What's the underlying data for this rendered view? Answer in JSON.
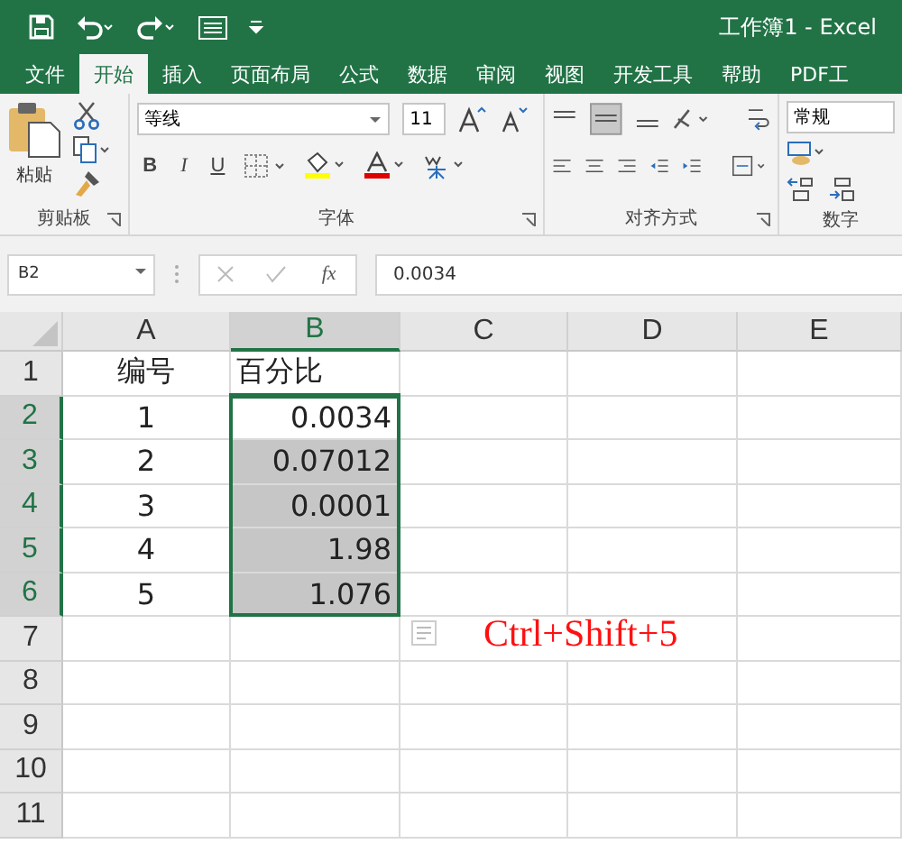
{
  "window": {
    "title": "工作簿1  -  Excel"
  },
  "tabs": [
    {
      "label": "文件",
      "selected": false
    },
    {
      "label": "开始",
      "selected": true
    },
    {
      "label": "插入",
      "selected": false
    },
    {
      "label": "页面布局",
      "selected": false
    },
    {
      "label": "公式",
      "selected": false
    },
    {
      "label": "数据",
      "selected": false
    },
    {
      "label": "审阅",
      "selected": false
    },
    {
      "label": "视图",
      "selected": false
    },
    {
      "label": "开发工具",
      "selected": false
    },
    {
      "label": "帮助",
      "selected": false
    },
    {
      "label": "PDF工",
      "selected": false
    }
  ],
  "ribbon": {
    "paste_label": "粘贴",
    "font_name": "等线",
    "font_size": "11",
    "number_format": "常规",
    "bold": "B",
    "italic": "I",
    "underline": "U",
    "groups": [
      "剪贴板",
      "字体",
      "对齐方式",
      "数字"
    ]
  },
  "formula_bar": {
    "name_box": "B2",
    "fx": "fx",
    "value": "0.0034"
  },
  "columns": [
    {
      "label": "A",
      "selected": false
    },
    {
      "label": "B",
      "selected": true
    },
    {
      "label": "C",
      "selected": false
    },
    {
      "label": "D",
      "selected": false
    },
    {
      "label": "E",
      "selected": false
    }
  ],
  "rows": [
    {
      "label": "1",
      "selected": false,
      "cells": [
        {
          "text": "编号",
          "kind": "centered",
          "selected": false,
          "active": false
        },
        {
          "text": "百分比",
          "kind": "text",
          "selected": false,
          "active": false
        }
      ]
    },
    {
      "label": "2",
      "selected": true,
      "cells": [
        {
          "text": "1",
          "kind": "centered",
          "selected": false,
          "active": false
        },
        {
          "text": "0.0034",
          "kind": "number",
          "selected": true,
          "active": true
        }
      ]
    },
    {
      "label": "3",
      "selected": true,
      "cells": [
        {
          "text": "2",
          "kind": "centered",
          "selected": false,
          "active": false
        },
        {
          "text": "0.07012",
          "kind": "number",
          "selected": true,
          "active": false
        }
      ]
    },
    {
      "label": "4",
      "selected": true,
      "cells": [
        {
          "text": "3",
          "kind": "centered",
          "selected": false,
          "active": false
        },
        {
          "text": "0.0001",
          "kind": "number",
          "selected": true,
          "active": false
        }
      ]
    },
    {
      "label": "5",
      "selected": true,
      "cells": [
        {
          "text": "4",
          "kind": "centered",
          "selected": false,
          "active": false
        },
        {
          "text": "1.98",
          "kind": "number",
          "selected": true,
          "active": false
        }
      ]
    },
    {
      "label": "6",
      "selected": true,
      "cells": [
        {
          "text": "5",
          "kind": "centered",
          "selected": false,
          "active": false
        },
        {
          "text": "1.076",
          "kind": "number",
          "selected": true,
          "active": false
        }
      ]
    },
    {
      "label": "7",
      "selected": false,
      "cells": []
    },
    {
      "label": "8",
      "selected": false,
      "cells": []
    },
    {
      "label": "9",
      "selected": false,
      "cells": []
    },
    {
      "label": "10",
      "selected": false,
      "cells": []
    },
    {
      "label": "11",
      "selected": false,
      "cells": []
    }
  ],
  "annotation": "Ctrl+Shift+5"
}
